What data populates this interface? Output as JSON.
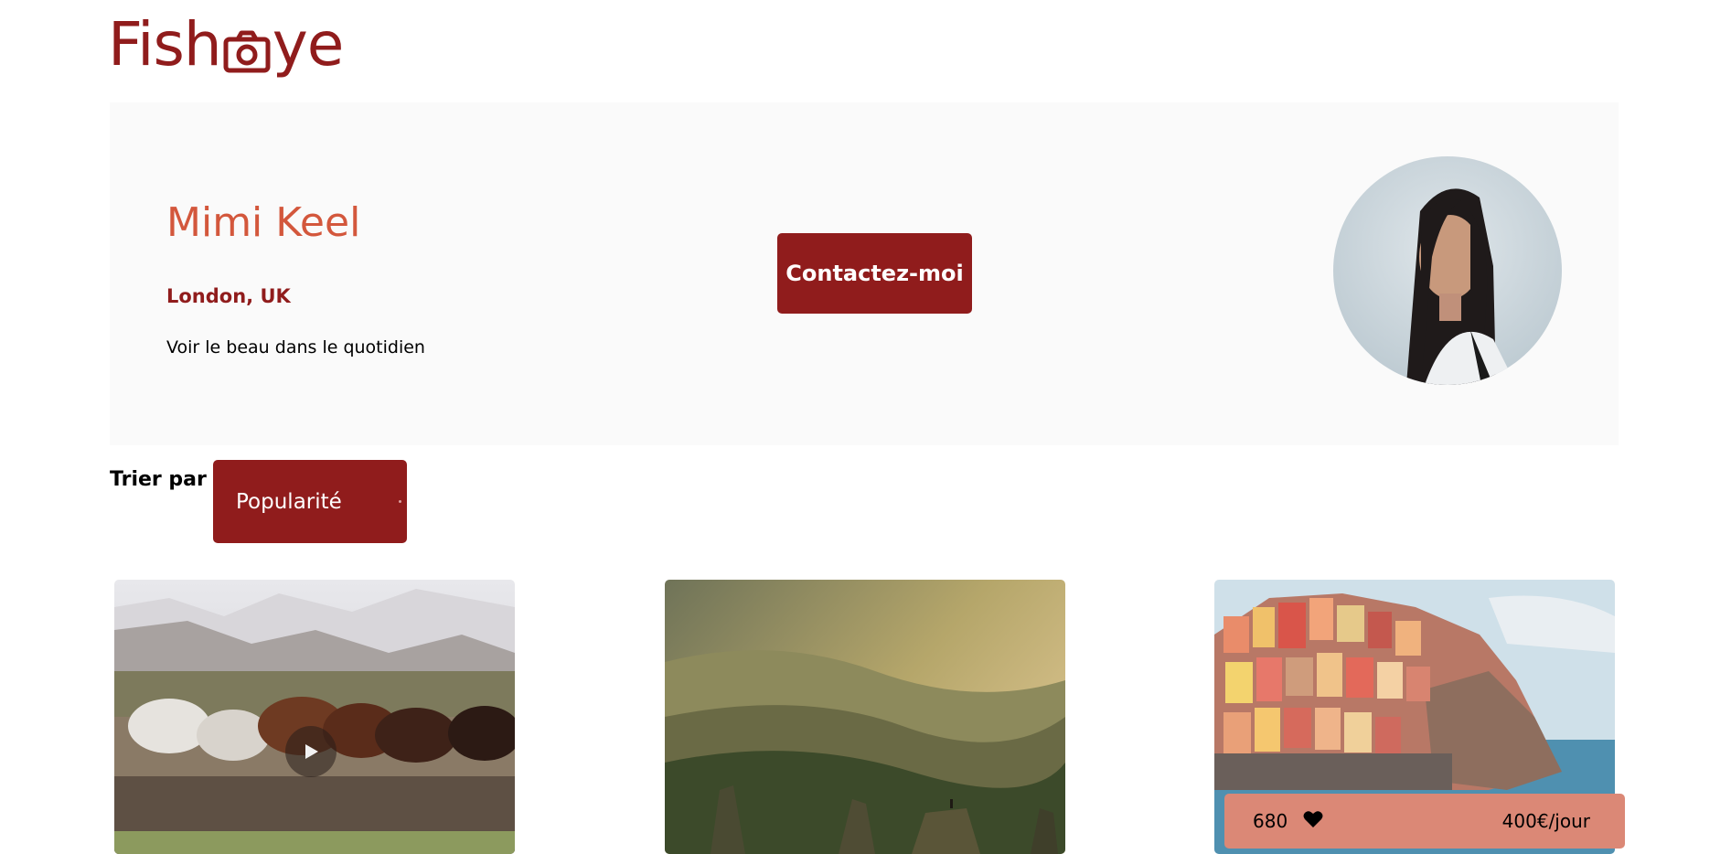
{
  "logo": {
    "text_before": "Fish",
    "text_after": "ye",
    "icon": "camera-icon"
  },
  "photographer": {
    "name": "Mimi Keel",
    "location": "London, UK",
    "tagline": "Voir le beau dans le quotidien",
    "contact_label": "Contactez-moi"
  },
  "sort": {
    "label": "Trier par",
    "selected": "Popularité"
  },
  "media": [
    {
      "type": "video",
      "icon": "play-icon"
    },
    {
      "type": "image"
    },
    {
      "type": "image",
      "likes": "680",
      "price": "400€/jour",
      "icon": "heart-icon"
    }
  ],
  "colors": {
    "primary": "#901C1C",
    "secondary": "#D3573C",
    "tertiary": "#DB8876",
    "banner": "#FAFAFA"
  }
}
